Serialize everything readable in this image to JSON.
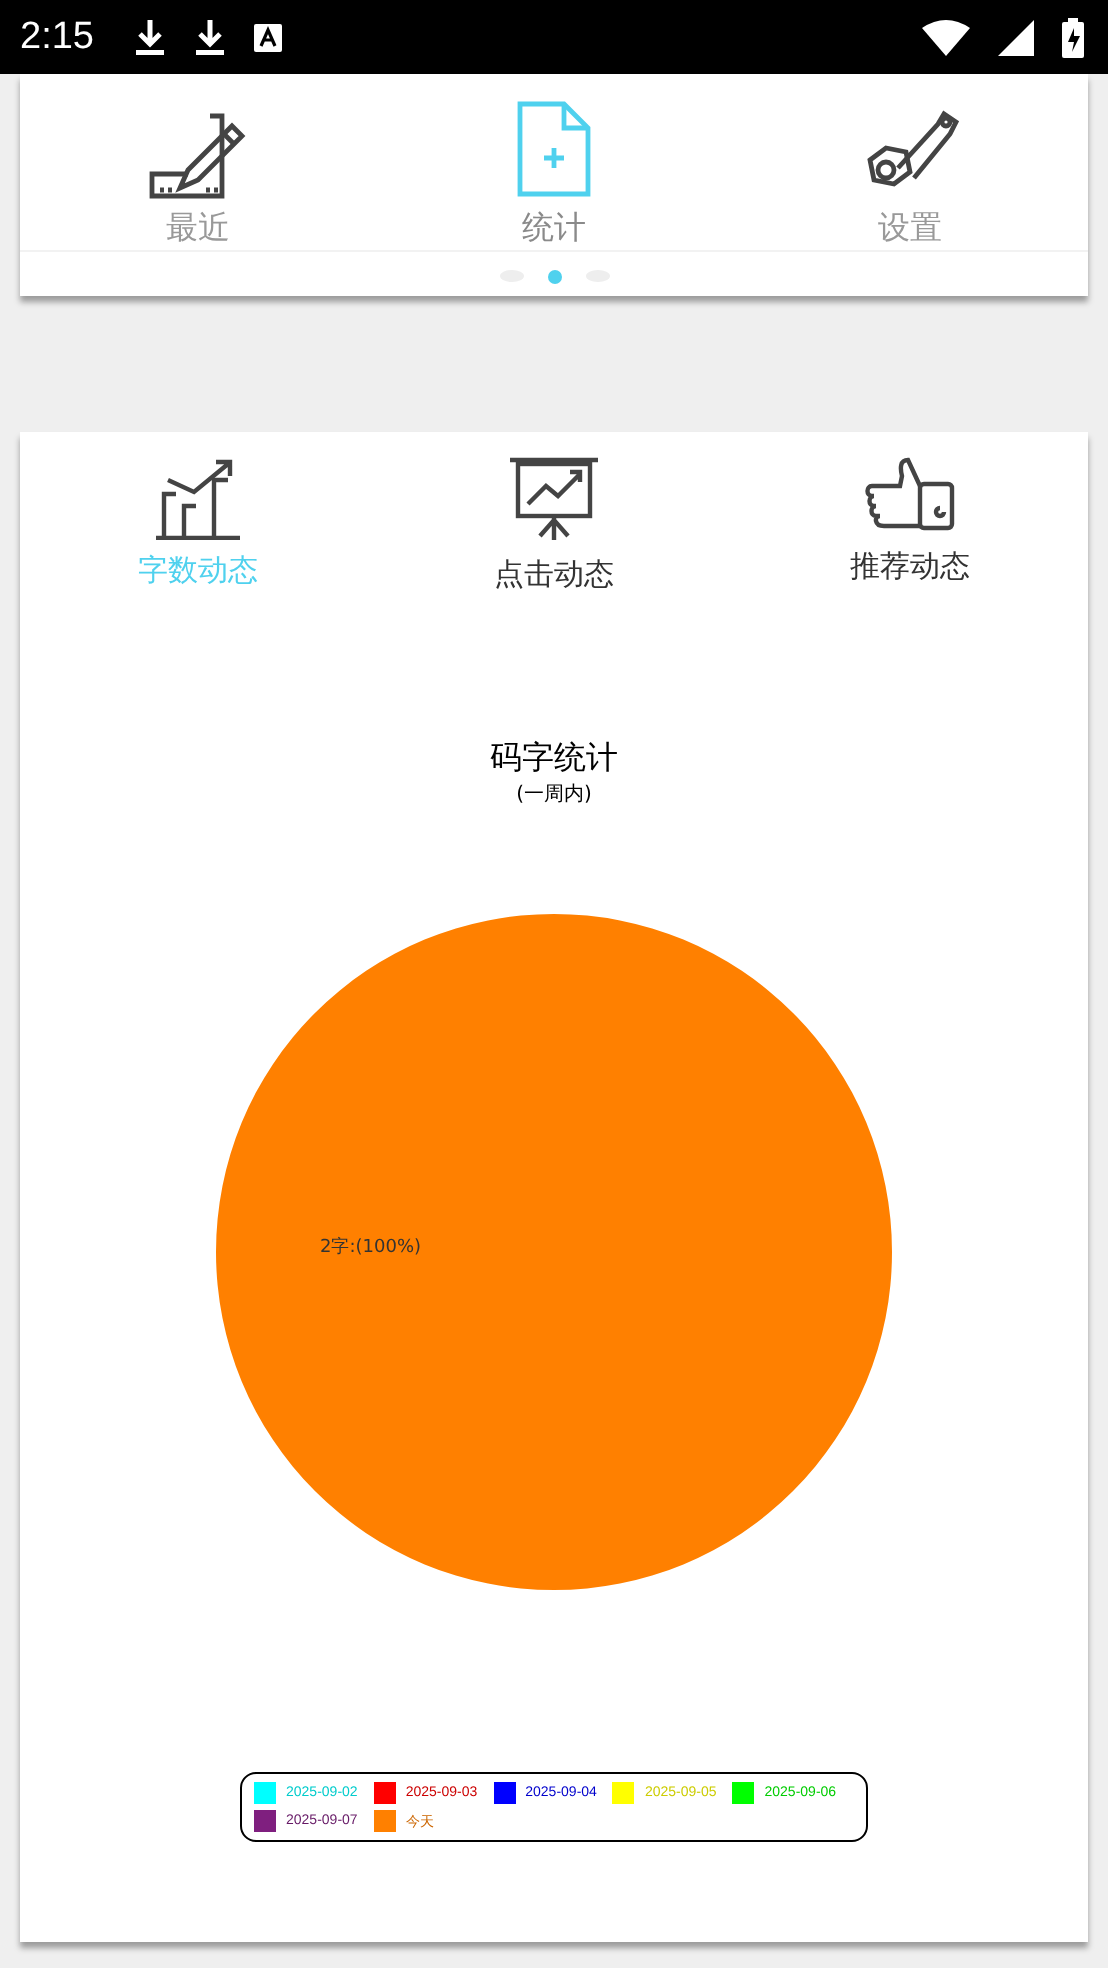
{
  "status_bar": {
    "time": "2:15"
  },
  "nav": [
    {
      "label": "最近",
      "selected": false,
      "kind": "pencil"
    },
    {
      "label": "统计",
      "selected": true,
      "kind": "doc"
    },
    {
      "label": "设置",
      "selected": false,
      "kind": "wrench"
    }
  ],
  "pager": [
    {
      "selected": false
    },
    {
      "selected": true
    },
    {
      "selected": false
    }
  ],
  "tabs": [
    {
      "label": "字数动态",
      "selected": true,
      "kind": "bars"
    },
    {
      "label": "点击动态",
      "selected": false,
      "kind": "board"
    },
    {
      "label": "推荐动态",
      "selected": false,
      "kind": "thumb"
    }
  ],
  "chart": {
    "subtitle": "(一周内)",
    "slice_label": "2字:(100%)",
    "chart_data": {
      "type": "pie",
      "title": "码字统计",
      "categories": [
        "2025-09-02",
        "2025-09-03",
        "2025-09-04",
        "2025-09-05",
        "2025-09-06",
        "2025-09-07",
        "今天"
      ],
      "series": [
        {
          "values": [
            0,
            0,
            0,
            0,
            0,
            0,
            100
          ]
        }
      ],
      "colors": [
        "#00ffff",
        "#ff0000",
        "#0000ff",
        "#ffff00",
        "#00ff00",
        "#7f1f7f",
        "#ff8000"
      ]
    }
  }
}
